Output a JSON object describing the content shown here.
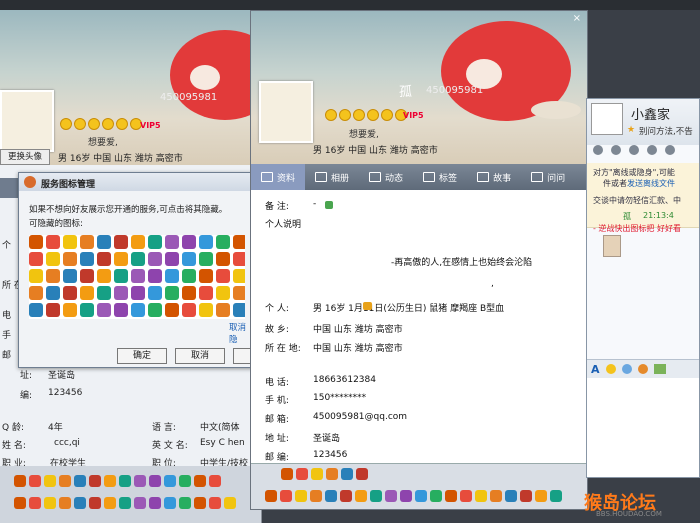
{
  "left": {
    "qq_number": "450095981",
    "vip": "VIP5",
    "motto": "想要爱,",
    "profile_line": "男   16岁   中国 山东 潍坊 高密市",
    "change_avatar": "更换头像",
    "dialog": {
      "title": "服务图标管理",
      "desc": "如果不想向好友展示您开通的服务,可点击将其隐藏。",
      "hidden_label": "可隐藏的图标:",
      "cancel_hide": "取消隐",
      "ok": "确定",
      "cancel": "取消"
    },
    "rows": [
      {
        "l": "个",
        "v": ""
      },
      {
        "l": "所 在",
        "v": ""
      },
      {
        "l": "电",
        "v": ""
      },
      {
        "l": "手",
        "v": ""
      },
      {
        "l": "邮",
        "v": ""
      }
    ],
    "addr": {
      "l": "址:",
      "v": "圣诞岛"
    },
    "zip": {
      "l": "编:",
      "v": "123456"
    },
    "age": {
      "l": "Q   龄:",
      "v": "4年"
    },
    "name": {
      "l": "姓   名:",
      "v": "ccc,qi"
    },
    "job": {
      "l": "职   业:",
      "v": "在校学生"
    },
    "lang": {
      "l": "语   言:",
      "v": "中文(简体"
    },
    "en": {
      "l": "英 文 名:",
      "v": "Esy C hen"
    },
    "pos": {
      "l": "职   位:",
      "v": "中学生/技校"
    }
  },
  "mid": {
    "nick": "孤",
    "qq_number": "450095981",
    "vip": "VIP5",
    "motto": "想要爱,",
    "profile_line": "男     16岁     中国 山东 潍坊 高密市",
    "close": "×",
    "tabs": [
      {
        "label": "资料"
      },
      {
        "label": "相册"
      },
      {
        "label": "动态"
      },
      {
        "label": "标签"
      },
      {
        "label": "故事"
      },
      {
        "label": "问问"
      }
    ],
    "note_label": "备   注:",
    "note_value": "-",
    "intro_label": "个人说明",
    "intro_text": "-再高傲的人,在感情上也始终会沦陷",
    "comma": ",",
    "personal": {
      "l": "个   人:",
      "v": "男   16岁       1月11日(公历生日)   鼠猪   摩羯座   B型血"
    },
    "hometown": {
      "l": "故   乡:",
      "v": "中国 山东 潍坊 高密市"
    },
    "location": {
      "l": "所 在 地:",
      "v": "中国 山东 潍坊 高密市"
    },
    "phone": {
      "l": "电   话:",
      "v": "18663612384"
    },
    "mobile": {
      "l": "手   机:",
      "v": "150********"
    },
    "email": {
      "l": "邮   箱:",
      "v": "450095981@qq.com"
    },
    "address": {
      "l": "地   址:",
      "v": "圣诞岛"
    },
    "zip": {
      "l": "邮   编:",
      "v": "123456"
    }
  },
  "right": {
    "name": "小鑫家",
    "status": "别问方法,不告",
    "msg1": "对方\"离线或隐身\",可能",
    "msg2": "件或者",
    "msg2_link": "发送离线文件",
    "msg3": "交谈中请勿轻信汇款、中",
    "time_name": "孤",
    "time": "21:13:4",
    "msg4": "- 逆战快出图标把  好好看",
    "font_btn": "A"
  },
  "watermark": {
    "text": "猴岛论坛",
    "url": "BBS.HOUDAO.COM"
  },
  "colors": {
    "tab_bg": "#6a7686",
    "tab_active": "#8a9bbf",
    "link": "#1a5fb4",
    "red_text": "#e0162b",
    "green_text": "#2c8a32"
  }
}
